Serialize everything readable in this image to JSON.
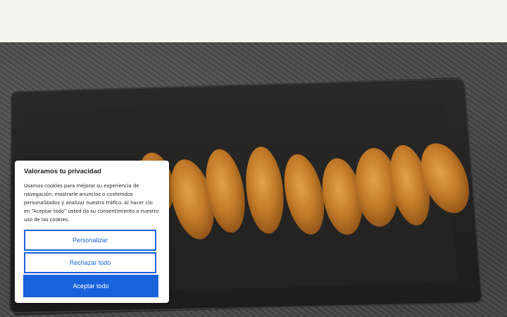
{
  "cookie_banner": {
    "title": "Valoramos tu privacidad",
    "text": "Usamos cookies para mejorar su experiencia de navegación, mostrarle anuncios o contenidos personalizados y analizar nuestro tráfico. Al hacer clic en “Aceptar todo” usted da su consentimiento a nuestro uso de las cookies.",
    "customize_label": "Personalizar",
    "reject_label": "Rechazar todo",
    "accept_label": "Aceptar todo"
  },
  "colors": {
    "accent": "#1863dc",
    "page_background": "#f3f2ec"
  }
}
